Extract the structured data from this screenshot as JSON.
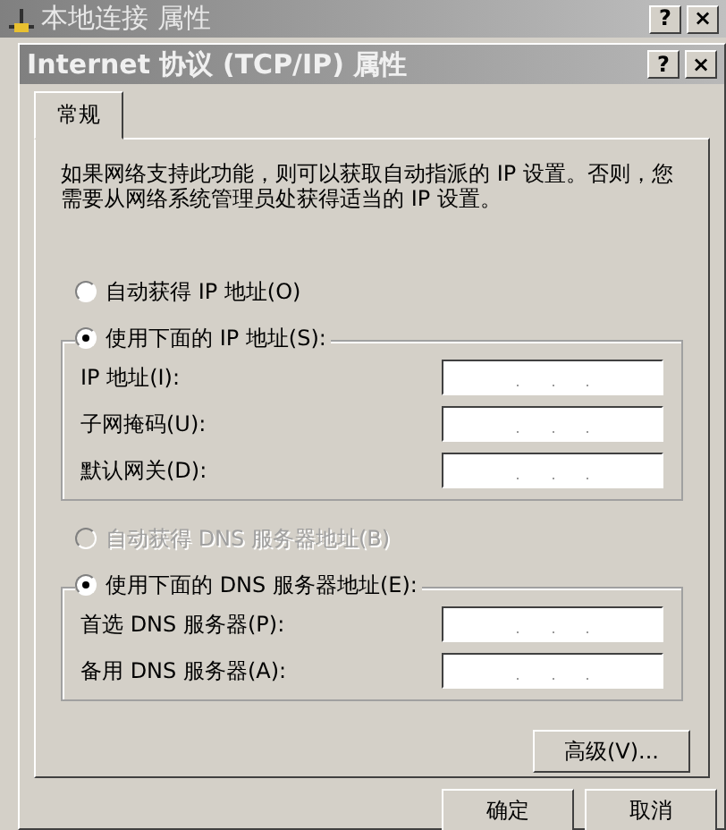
{
  "outer_window": {
    "title": "本地连接 属性",
    "buttons": [
      "?",
      "×"
    ]
  },
  "dialog": {
    "title": "Internet 协议 (TCP/IP) 属性",
    "buttons": [
      "?",
      "×"
    ]
  },
  "tabs": [
    {
      "label": "常规",
      "selected": true
    }
  ],
  "description": "如果网络支持此功能，则可以获取自动指派的 IP 设置。否则，您需要从网络系统管理员处获得适当的 IP 设置。",
  "ip": {
    "auto_radio": {
      "label": "自动获得 IP 地址(O)",
      "selected": false,
      "disabled": false
    },
    "manual_radio": {
      "label": "使用下面的 IP 地址(S):",
      "selected": true,
      "disabled": false
    },
    "fields": [
      {
        "label": "IP 地址(I):"
      },
      {
        "label": "子网掩码(U):"
      },
      {
        "label": "默认网关(D):"
      }
    ]
  },
  "dns": {
    "auto_radio": {
      "label": "自动获得 DNS 服务器地址(B)",
      "selected": false,
      "disabled": true
    },
    "manual_radio": {
      "label": "使用下面的 DNS 服务器地址(E):",
      "selected": true,
      "disabled": false
    },
    "fields": [
      {
        "label": "首选 DNS 服务器(P):"
      },
      {
        "label": "备用 DNS 服务器(A):"
      }
    ]
  },
  "advanced_button": "高级(V)...",
  "buttons": [
    "确定",
    "取消"
  ]
}
